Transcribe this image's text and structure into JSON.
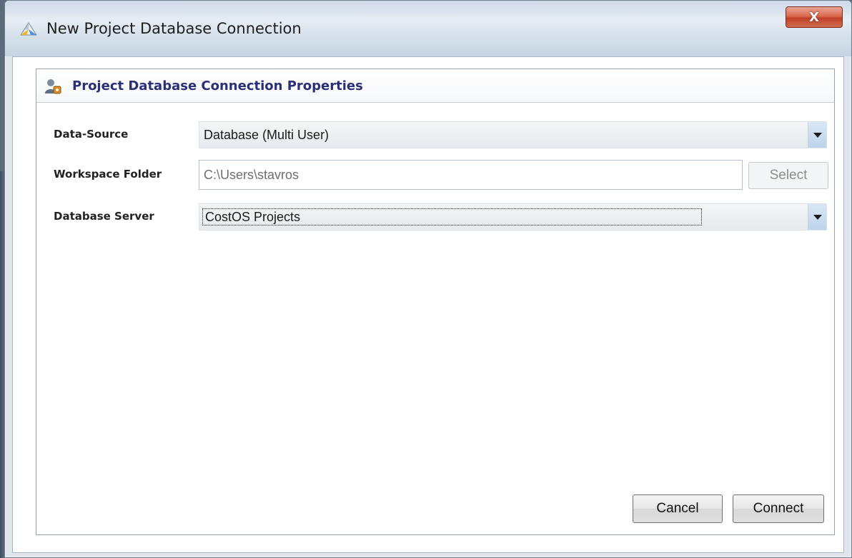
{
  "window": {
    "title": "New Project Database Connection",
    "close_label": "X"
  },
  "panel": {
    "title": "Project Database Connection Properties"
  },
  "form": {
    "data_source": {
      "label": "Data-Source",
      "value": "Database (Multi User)"
    },
    "workspace_folder": {
      "label": "Workspace Folder",
      "value": "C:\\Users\\stavros",
      "select_label": "Select"
    },
    "database_server": {
      "label": "Database Server",
      "value": "CostOS Projects"
    }
  },
  "buttons": {
    "cancel": "Cancel",
    "connect": "Connect"
  },
  "colors": {
    "panel_title": "#2a2f78",
    "close_button": "#c1402a"
  }
}
